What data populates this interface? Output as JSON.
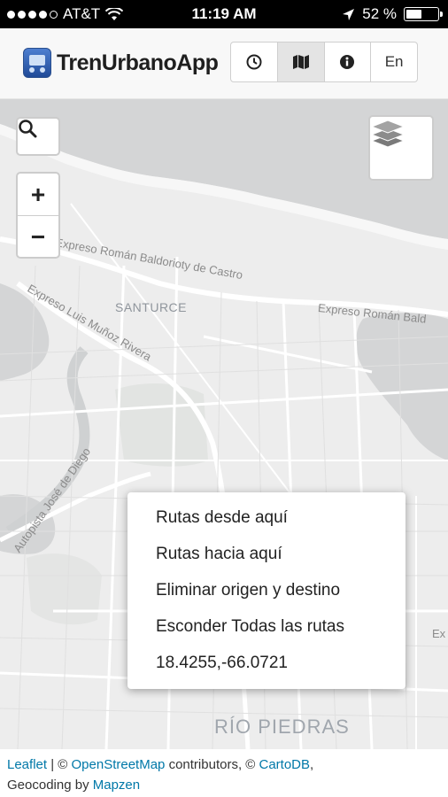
{
  "status_bar": {
    "carrier": "AT&T",
    "time": "11:19 AM",
    "battery": "52 %",
    "battery_level": 0.52
  },
  "header": {
    "app_name": "TrenUrbanoApp",
    "nav_buttons": [
      {
        "icon": "clock-icon",
        "active": false
      },
      {
        "icon": "map-icon",
        "active": true
      },
      {
        "icon": "info-icon",
        "active": false
      }
    ],
    "language_label": "En"
  },
  "map": {
    "search_icon": "search-icon",
    "zoom_in_label": "+",
    "zoom_out_label": "−",
    "layers_icon": "layers-icon",
    "labels": {
      "expreso_baldorioty": "Expreso Román Baldorioty de Castro",
      "expreso_roman_bald": "Expreso Román Bald",
      "santurce": "SANTURCE",
      "expreso_munoz_rivera": "Expreso Luis Muñoz Rivera",
      "autopista_diego": "Autopista José de Diego",
      "rio_piedras": "RÍO PIEDRAS",
      "ex_edge": "Ex"
    }
  },
  "context_menu": {
    "items": [
      "Rutas desde aquí",
      "Rutas hacia aquí",
      "Eliminar origen y destino",
      "Esconder Todas las rutas",
      "18.4255,-66.0721"
    ]
  },
  "attribution": {
    "leaflet": "Leaflet",
    "sep1": " | © ",
    "osm": "OpenStreetMap",
    "contributors": " contributors, © ",
    "cartodb": "CartoDB",
    "comma": ",",
    "geocoding": "Geocoding by ",
    "mapzen": "Mapzen"
  }
}
